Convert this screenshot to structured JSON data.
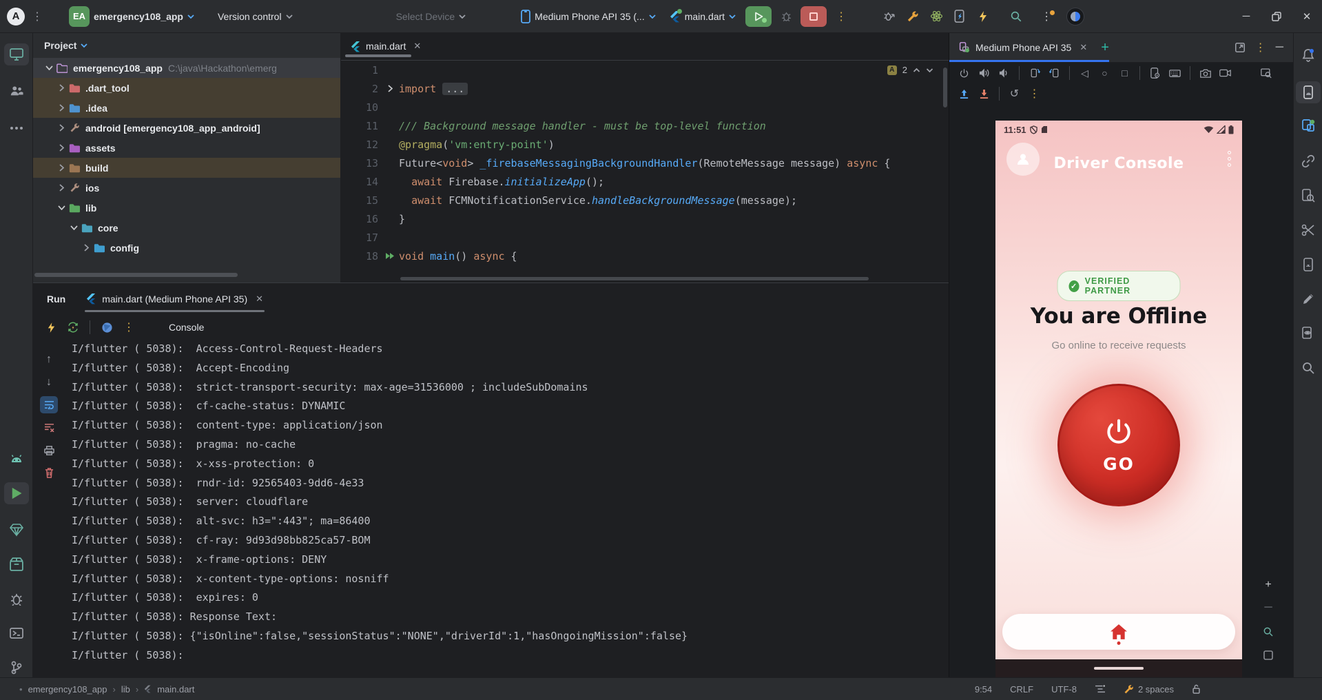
{
  "titlebar": {
    "logo_letter": "A",
    "ea_badge": "EA",
    "project_name": "emergency108_app",
    "vcs_label": "Version control",
    "select_device_label": "Select Device",
    "device_name": "Medium Phone API 35 (...",
    "run_config": "main.dart"
  },
  "left_stripe": {
    "icons": [
      "project-monitor-icon",
      "structure-users-icon",
      "more-tools-icon",
      "logcat-android-icon",
      "run-play-icon",
      "app-insights-gem-icon",
      "build-package-icon",
      "problems-bug-icon",
      "terminal-icon",
      "git-branch-icon"
    ]
  },
  "right_stripe": {
    "icons": [
      "notifications-bell-icon",
      "running-devices-icon",
      "device-manager-icon",
      "gradle-link-icon",
      "app-inspection-icon",
      "profiler-scissors-icon",
      "emulator-phone-icon",
      "gemini-pencil-icon",
      "layout-inspector-icon",
      "find-usages-search-icon"
    ]
  },
  "project": {
    "header": "Project",
    "tree": [
      {
        "depth": 0,
        "icon": "project",
        "label": "emergency108_app",
        "path": "C:\\java\\Hackathon\\emerg",
        "expanded": true,
        "selected": true
      },
      {
        "depth": 1,
        "icon": "dart_tool",
        "label": ".dart_tool",
        "excluded": true
      },
      {
        "depth": 1,
        "icon": "idea",
        "label": ".idea",
        "excluded": true
      },
      {
        "depth": 1,
        "icon": "wrench",
        "label": "android [emergency108_app_android]"
      },
      {
        "depth": 1,
        "icon": "assets",
        "label": "assets"
      },
      {
        "depth": 1,
        "icon": "build",
        "label": "build",
        "excluded": true
      },
      {
        "depth": 1,
        "icon": "wrench",
        "label": "ios"
      },
      {
        "depth": 1,
        "icon": "lib",
        "label": "lib",
        "expanded": true
      },
      {
        "depth": 2,
        "icon": "core",
        "label": "core",
        "expanded": true
      },
      {
        "depth": 3,
        "icon": "config",
        "label": "config"
      }
    ]
  },
  "editor": {
    "tab_label": "main.dart",
    "inspection_count": "2",
    "lines": [
      {
        "n": "1",
        "code": []
      },
      {
        "n": "2",
        "fold": true,
        "code": [
          [
            "kw",
            "import"
          ],
          [
            "pl",
            " "
          ],
          [
            "fold",
            "..."
          ]
        ]
      },
      {
        "n": "10",
        "code": []
      },
      {
        "n": "11",
        "code": [
          [
            "cmt",
            "/// Background message handler - must be top-level function"
          ]
        ]
      },
      {
        "n": "12",
        "code": [
          [
            "meta",
            "@pragma"
          ],
          [
            "pl",
            "("
          ],
          [
            "str",
            "'vm:entry-point'"
          ],
          [
            "pl",
            ")"
          ]
        ]
      },
      {
        "n": "13",
        "code": [
          [
            "pl",
            "Future<"
          ],
          [
            "kw",
            "void"
          ],
          [
            "pl",
            "> "
          ],
          [
            "fn",
            "_firebaseMessagingBackgroundHandler"
          ],
          [
            "pl",
            "(RemoteMessage message) "
          ],
          [
            "kw",
            "async"
          ],
          [
            "pl",
            " {"
          ]
        ]
      },
      {
        "n": "14",
        "code": [
          [
            "pl",
            "  "
          ],
          [
            "kw",
            "await"
          ],
          [
            "pl",
            " Firebase."
          ],
          [
            "fni",
            "initializeApp"
          ],
          [
            "pl",
            "();"
          ]
        ]
      },
      {
        "n": "15",
        "code": [
          [
            "pl",
            "  "
          ],
          [
            "kw",
            "await"
          ],
          [
            "pl",
            " FCMNotificationService."
          ],
          [
            "fni",
            "handleBackgroundMessage"
          ],
          [
            "pl",
            "(message);"
          ]
        ]
      },
      {
        "n": "16",
        "code": [
          [
            "pl",
            "}"
          ]
        ]
      },
      {
        "n": "17",
        "code": []
      },
      {
        "n": "18",
        "run": true,
        "code": [
          [
            "kw",
            "void"
          ],
          [
            "pl",
            " "
          ],
          [
            "fn",
            "main"
          ],
          [
            "pl",
            "() "
          ],
          [
            "kw",
            "async"
          ],
          [
            "pl",
            " {"
          ]
        ]
      }
    ]
  },
  "run_panel": {
    "label": "Run",
    "tab_label": "main.dart (Medium Phone API 35)",
    "console_label": "Console",
    "console_lines": [
      "I/flutter ( 5038):  Access-Control-Request-Headers",
      "I/flutter ( 5038):  Accept-Encoding",
      "I/flutter ( 5038):  strict-transport-security: max-age=31536000 ; includeSubDomains",
      "I/flutter ( 5038):  cf-cache-status: DYNAMIC",
      "I/flutter ( 5038):  content-type: application/json",
      "I/flutter ( 5038):  pragma: no-cache",
      "I/flutter ( 5038):  x-xss-protection: 0",
      "I/flutter ( 5038):  rndr-id: 92565403-9dd6-4e33",
      "I/flutter ( 5038):  server: cloudflare",
      "I/flutter ( 5038):  alt-svc: h3=\":443\"; ma=86400",
      "I/flutter ( 5038):  cf-ray: 9d93d98bb825ca57-BOM",
      "I/flutter ( 5038):  x-frame-options: DENY",
      "I/flutter ( 5038):  x-content-type-options: nosniff",
      "I/flutter ( 5038):  expires: 0",
      "I/flutter ( 5038): Response Text:",
      "I/flutter ( 5038): {\"isOnline\":false,\"sessionStatus\":\"NONE\",\"driverId\":1,\"hasOngoingMission\":false}",
      "I/flutter ( 5038):"
    ]
  },
  "emulator": {
    "tab_label": "Medium Phone API 35",
    "phone": {
      "time": "11:51",
      "app_title": "Driver Console",
      "badge": "VERIFIED PARTNER",
      "headline": "You are Offline",
      "subtext": "Go online to receive requests",
      "go_label": "GO"
    }
  },
  "status_bar": {
    "breadcrumbs": [
      "emergency108_app",
      "lib",
      "main.dart"
    ],
    "caret_position": "9:54",
    "line_separator": "CRLF",
    "encoding": "UTF-8",
    "indent": "2 spaces"
  },
  "colors": {
    "accent": "#3574f0",
    "go_red": "#c62828",
    "verified_green": "#3f9a46",
    "run_green": "#57965c"
  }
}
